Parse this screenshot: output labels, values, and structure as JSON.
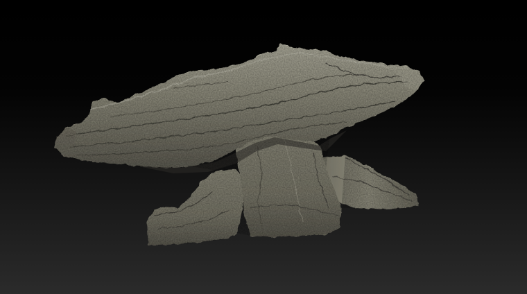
{
  "viewport": {
    "background_top": "#000000",
    "background_bottom": "#2b2b2b"
  },
  "model": {
    "icon": "rock-sculpt-mesh",
    "base_color": "#8c8a7a",
    "highlight_color": "#b4b2a2",
    "shadow_color": "#4a4840",
    "crease_color": "#3a3832"
  }
}
